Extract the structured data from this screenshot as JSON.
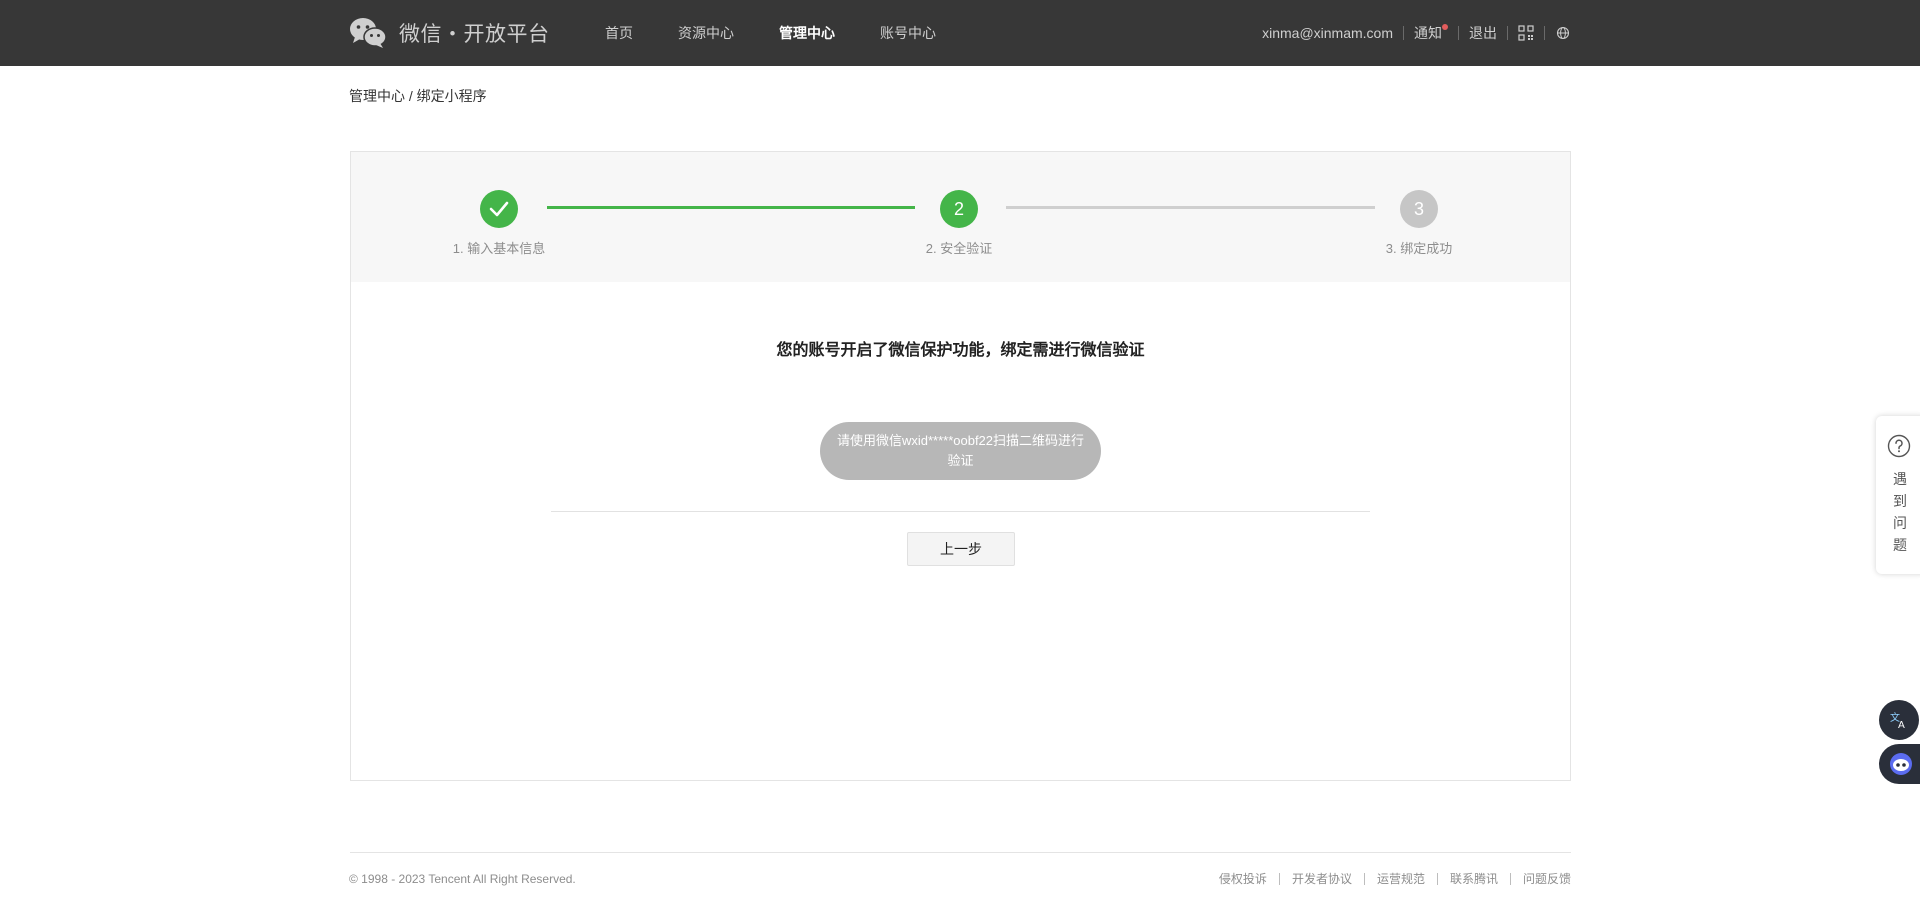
{
  "header": {
    "logo_text": "微信・开放平台",
    "nav": [
      "首页",
      "资源中心",
      "管理中心",
      "账号中心"
    ],
    "account": "xinma@xinmam.com",
    "notify_label": "通知",
    "logout_label": "退出"
  },
  "breadcrumb": {
    "parent": "管理中心",
    "separator": " / ",
    "current": "绑定小程序"
  },
  "steps": {
    "step1_label": "1. 输入基本信息",
    "step2_number": "2",
    "step2_label": "2. 安全验证",
    "step3_number": "3",
    "step3_label": "3. 绑定成功",
    "current_step": 2
  },
  "verify": {
    "title": "您的账号开启了微信保护功能，绑定需进行微信验证",
    "qr_button_label": "请使用微信wxid*****oobf22扫描二维码进行验证",
    "prev_button_label": "上一步"
  },
  "help_tab": {
    "label": "遇到问题"
  },
  "footer": {
    "copyright": "© 1998 - 2023 Tencent All Right Reserved.",
    "links": [
      "侵权投诉",
      "开发者协议",
      "运营规范",
      "联系腾讯",
      "问题反馈"
    ]
  },
  "colors": {
    "header_bg": "#373737",
    "accent_green": "#44b549",
    "inactive_gray": "#c6c6c6",
    "notify_dot": "#e25c5c"
  }
}
